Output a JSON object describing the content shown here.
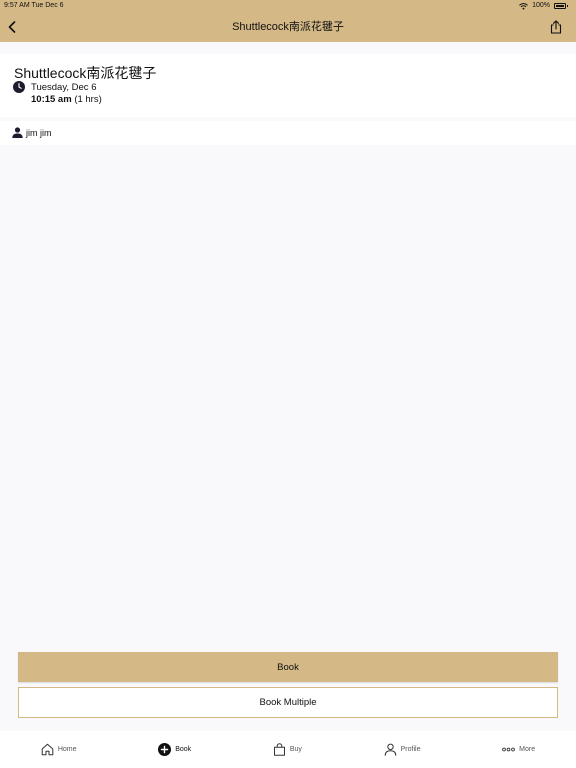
{
  "status_bar": {
    "time_date": "9:57 AM  Tue Dec 6",
    "battery": "100%"
  },
  "nav": {
    "title": "Shuttlecock南派花毽子"
  },
  "event": {
    "title": "Shuttlecock南派花毽子",
    "date": "Tuesday, Dec 6",
    "time": "10:15 am",
    "duration": "(1 hrs)"
  },
  "instructor": {
    "name": "jim jim"
  },
  "actions": {
    "book_label": "Book",
    "book_multiple_label": "Book Multiple"
  },
  "tabs": [
    {
      "label": "Home",
      "icon": "home-icon"
    },
    {
      "label": "Book",
      "icon": "plus-circle-icon"
    },
    {
      "label": "Buy",
      "icon": "shopping-bag-icon"
    },
    {
      "label": "Profile",
      "icon": "person-icon"
    },
    {
      "label": "More",
      "icon": "more-dots-icon"
    }
  ],
  "colors": {
    "brand": "#d4b886",
    "background": "#f9f9fb",
    "card": "#ffffff"
  }
}
